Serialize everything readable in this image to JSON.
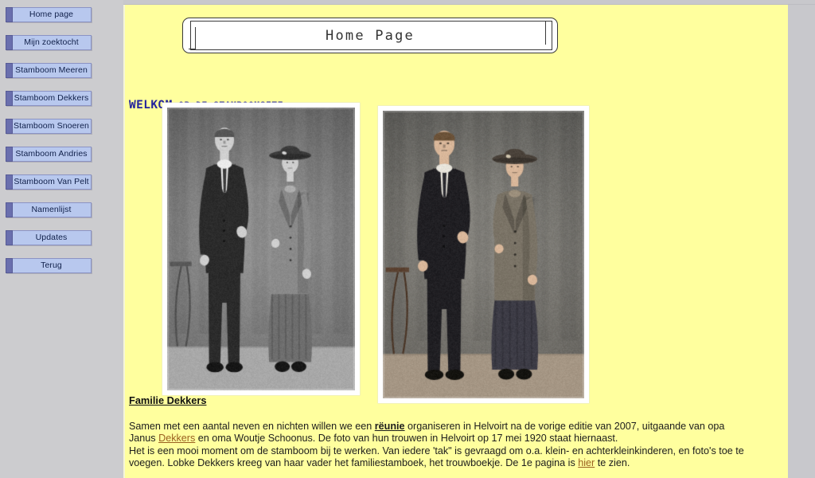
{
  "sidebar": {
    "items": [
      {
        "label": "Home page"
      },
      {
        "label": "Mijn zoektocht"
      },
      {
        "label": "Stamboom Meeren"
      },
      {
        "label": "Stamboom Dekkers"
      },
      {
        "label": "Stamboom Snoeren"
      },
      {
        "label": "Stamboom Andries"
      },
      {
        "label": "Stamboom Van Pelt"
      },
      {
        "label": "Namenlijst"
      },
      {
        "label": "Updates"
      },
      {
        "label": "Terug"
      }
    ]
  },
  "banner": {
    "title": "Home Page"
  },
  "welcome": {
    "big": "WELKOM",
    "small": " OP DE STAMBOOMSITE"
  },
  "photos": [
    {
      "name": "wedding-photo-black-and-white",
      "alt": "Zwart-wit trouwfoto van Janus Dekkers en Woutje Schoonus, Helvoirt 17 mei 1920"
    },
    {
      "name": "wedding-photo-colorized",
      "alt": "Ingekleurde trouwfoto van Janus Dekkers en Woutje Schoonus, Helvoirt 17 mei 1920"
    }
  ],
  "article": {
    "heading": "Familie Dekkers",
    "line1_a": "Samen met een aantal neven en nichten willen we een ",
    "link_reunie": "rëunie",
    "line1_b": " organiseren in Helvoirt na de vorige editie van 2007, uitgaande van opa",
    "line2_a": "Janus ",
    "link_dekkers": "Dekkers",
    "line2_b": " en oma Woutje Schoonus. De foto van hun trouwen in Helvoirt op 17 mei 1920 staat hiernaast.",
    "line3": "Het is een mooi moment om de stamboom bij te werken. Van iedere 'tak\" is gevraagd om o.a. klein- en achterkleinkinderen, en foto's toe te",
    "line4_a": "voegen. Lobke Dekkers kreeg van haar vader het familiestamboek, het trouwboekje. De 1e pagina is ",
    "link_hier": "hier",
    "line4_b": " te zien."
  },
  "colors": {
    "page_background": "#c8c8cc",
    "sidebar_background": "#cccccf",
    "content_background": "#ffff9e",
    "button_face": "#b8c8ee",
    "button_tab": "#6a6fae",
    "heading_blue": "#23239c",
    "link_brown": "#9a6020"
  }
}
